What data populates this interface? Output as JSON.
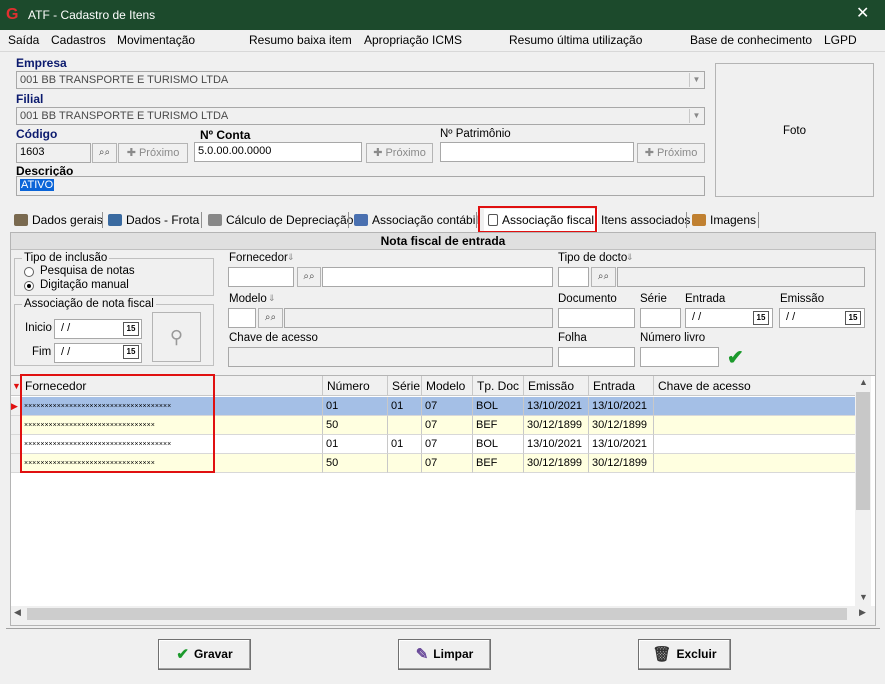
{
  "window": {
    "title": "ATF - Cadastro de Itens",
    "close": "✕"
  },
  "menu": [
    "Saída",
    "Cadastros",
    "Movimentação",
    "Resumo baixa item",
    "Apropriação ICMS",
    "Resumo última utilização",
    "Base de conhecimento",
    "LGPD"
  ],
  "form": {
    "empresa_label": "Empresa",
    "empresa_value": "001 BB TRANSPORTE E TURISMO LTDA",
    "filial_label": "Filial",
    "filial_value": "001 BB TRANSPORTE E TURISMO LTDA",
    "codigo_label": "Código",
    "codigo_value": "1603",
    "conta_label": "Nº Conta",
    "conta_value": "5.0.00.00.0000",
    "patrimonio_label": "Nº Patrimônio",
    "patrimonio_value": "",
    "proximo_label": "Próximo",
    "descricao_label": "Descrição",
    "descricao_value": "ATIVO",
    "foto_label": "Foto"
  },
  "tabs": [
    "Dados gerais",
    "Dados - Frota",
    "Cálculo de Depreciação",
    "Associação contábil",
    "Associação fiscal",
    "Itens associados",
    "Imagens"
  ],
  "active_tab": "Associação fiscal",
  "nf": {
    "header": "Nota fiscal de entrada",
    "tipo_inclusao_label": "Tipo de inclusão",
    "radio_pesquisa": "Pesquisa de notas",
    "radio_digitacao": "Digitação manual",
    "radio_selected": "Digitação manual",
    "assoc_label": "Associação de nota fiscal",
    "inicio_label": "Inicio",
    "fim_label": "Fim",
    "date_placeholder": "/ /",
    "fornecedor_label": "Fornecedor",
    "modelo_label": "Modelo",
    "chave_label": "Chave de acesso",
    "tipo_docto_label": "Tipo de docto",
    "documento_label": "Documento",
    "serie_label": "Série",
    "entrada_label": "Entrada",
    "emissao_label": "Emissão",
    "folha_label": "Folha",
    "numero_livro_label": "Número livro"
  },
  "grid": {
    "columns": [
      "Fornecedor",
      "Número",
      "Série",
      "Modelo",
      "Tp. Doc",
      "Emissão",
      "Entrada",
      "Chave de acesso"
    ],
    "rows": [
      {
        "fornecedor": "××××××××××××××××××××××××××××××××××××",
        "numero": "01",
        "serie": "01",
        "modelo": "07",
        "tpdoc": "BOL",
        "emissao": "13/10/2021",
        "entrada": "13/10/2021",
        "chave": ""
      },
      {
        "fornecedor": "××××××××××××××××××××××××××××××××",
        "numero": "50",
        "serie": "",
        "modelo": "07",
        "tpdoc": "BEF",
        "emissao": "30/12/1899",
        "entrada": "30/12/1899",
        "chave": ""
      },
      {
        "fornecedor": "××××××××××××××××××××××××××××××××××××",
        "numero": "01",
        "serie": "01",
        "modelo": "07",
        "tpdoc": "BOL",
        "emissao": "13/10/2021",
        "entrada": "13/10/2021",
        "chave": ""
      },
      {
        "fornecedor": "××××××××××××××××××××××××××××××××",
        "numero": "50",
        "serie": "",
        "modelo": "07",
        "tpdoc": "BEF",
        "emissao": "30/12/1899",
        "entrada": "30/12/1899",
        "chave": ""
      }
    ]
  },
  "buttons": {
    "gravar": "Gravar",
    "limpar": "Limpar",
    "excluir": "Excluir"
  },
  "colors": {
    "titlebar": "#1c4a2c",
    "highlight": "#e01010",
    "selected_row": "#a4bfe6",
    "alt_row": "#ffffe0",
    "label_blue": "#0b1a6e"
  }
}
